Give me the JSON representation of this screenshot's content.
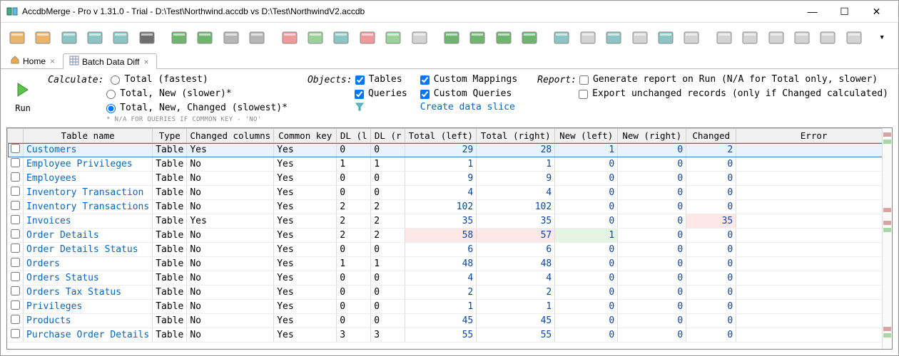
{
  "window": {
    "title": "AccdbMerge - Pro v 1.31.0 - Trial - D:\\Test\\Northwind.accdb vs D:\\Test\\NorthwindV2.accdb"
  },
  "tabs": {
    "home": "Home",
    "batch": "Batch Data Diff"
  },
  "toolbar_icons": [
    "open-left",
    "open-right",
    "open-pair",
    "select",
    "layout",
    "find",
    "refresh",
    "export-excel",
    "prev",
    "next",
    "filter-1",
    "filter-2",
    "filter-3",
    "filter-4",
    "filter-5",
    "filter-6",
    "copy-down",
    "copy-up",
    "copy-down-alt",
    "copy-up-alt",
    "check-1",
    "check-2",
    "check-copy-1",
    "check-copy-2",
    "check-del-1",
    "check-del-2",
    "doc-1",
    "doc-2",
    "doc-copy-1",
    "doc-copy-2",
    "doc-del-1",
    "doc-del-2"
  ],
  "options": {
    "run_label": "Run",
    "calculate_label": "Calculate:",
    "calc_opts": [
      "Total (fastest)",
      "Total, New (slower)*",
      "Total, New, Changed (slowest)*"
    ],
    "calc_note": "* N/A for queries if common key - 'No'",
    "objects_label": "Objects:",
    "objects_tables": "Tables",
    "objects_queries": "Queries",
    "custom_mappings": "Custom Mappings",
    "custom_queries": "Custom Queries",
    "create_slice": "Create data slice",
    "report_label": "Report:",
    "report_gen": "Generate report on Run (N/A for Total only, slower)",
    "report_export": "Export unchanged records (only if Changed calculated)"
  },
  "columns": [
    "",
    "Table name",
    "Type",
    "Changed columns",
    "Common key",
    "DL (l",
    "DL (r",
    "Total (left)",
    "Total (right)",
    "New (left)",
    "New (right)",
    "Changed",
    "Error"
  ],
  "rows": [
    {
      "name": "Customers",
      "type": "Table",
      "chg": "Yes",
      "ck": "Yes",
      "dll": "0",
      "dlr": "0",
      "tl": "29",
      "tr": "28",
      "nl": "1",
      "nr": "0",
      "c": "2",
      "hl": {
        "tl": "pink",
        "tr": "pink",
        "nl": "green",
        "c": "pink"
      },
      "sel": true
    },
    {
      "name": "Employee Privileges",
      "type": "Table",
      "chg": "No",
      "ck": "Yes",
      "dll": "1",
      "dlr": "1",
      "tl": "1",
      "tr": "1",
      "nl": "0",
      "nr": "0",
      "c": "0"
    },
    {
      "name": "Employees",
      "type": "Table",
      "chg": "No",
      "ck": "Yes",
      "dll": "0",
      "dlr": "0",
      "tl": "9",
      "tr": "9",
      "nl": "0",
      "nr": "0",
      "c": "0"
    },
    {
      "name": "Inventory Transaction",
      "type": "Table",
      "chg": "No",
      "ck": "Yes",
      "dll": "0",
      "dlr": "0",
      "tl": "4",
      "tr": "4",
      "nl": "0",
      "nr": "0",
      "c": "0"
    },
    {
      "name": "Inventory Transactions",
      "type": "Table",
      "chg": "No",
      "ck": "Yes",
      "dll": "2",
      "dlr": "2",
      "tl": "102",
      "tr": "102",
      "nl": "0",
      "nr": "0",
      "c": "0"
    },
    {
      "name": "Invoices",
      "type": "Table",
      "chg": "Yes",
      "ck": "Yes",
      "dll": "2",
      "dlr": "2",
      "tl": "35",
      "tr": "35",
      "nl": "0",
      "nr": "0",
      "c": "35",
      "hl": {
        "c": "pink"
      }
    },
    {
      "name": "Order Details",
      "type": "Table",
      "chg": "No",
      "ck": "Yes",
      "dll": "2",
      "dlr": "2",
      "tl": "58",
      "tr": "57",
      "nl": "1",
      "nr": "0",
      "c": "0",
      "hl": {
        "tl": "pink",
        "tr": "pink",
        "nl": "green"
      }
    },
    {
      "name": "Order Details Status",
      "type": "Table",
      "chg": "No",
      "ck": "Yes",
      "dll": "0",
      "dlr": "0",
      "tl": "6",
      "tr": "6",
      "nl": "0",
      "nr": "0",
      "c": "0"
    },
    {
      "name": "Orders",
      "type": "Table",
      "chg": "No",
      "ck": "Yes",
      "dll": "1",
      "dlr": "1",
      "tl": "48",
      "tr": "48",
      "nl": "0",
      "nr": "0",
      "c": "0"
    },
    {
      "name": "Orders Status",
      "type": "Table",
      "chg": "No",
      "ck": "Yes",
      "dll": "0",
      "dlr": "0",
      "tl": "4",
      "tr": "4",
      "nl": "0",
      "nr": "0",
      "c": "0"
    },
    {
      "name": "Orders Tax Status",
      "type": "Table",
      "chg": "No",
      "ck": "Yes",
      "dll": "0",
      "dlr": "0",
      "tl": "2",
      "tr": "2",
      "nl": "0",
      "nr": "0",
      "c": "0"
    },
    {
      "name": "Privileges",
      "type": "Table",
      "chg": "No",
      "ck": "Yes",
      "dll": "0",
      "dlr": "0",
      "tl": "1",
      "tr": "1",
      "nl": "0",
      "nr": "0",
      "c": "0"
    },
    {
      "name": "Products",
      "type": "Table",
      "chg": "No",
      "ck": "Yes",
      "dll": "0",
      "dlr": "0",
      "tl": "45",
      "tr": "45",
      "nl": "0",
      "nr": "0",
      "c": "0"
    },
    {
      "name": "Purchase Order Details",
      "type": "Table",
      "chg": "No",
      "ck": "Yes",
      "dll": "3",
      "dlr": "3",
      "tl": "55",
      "tr": "55",
      "nl": "0",
      "nr": "0",
      "c": "0"
    }
  ]
}
